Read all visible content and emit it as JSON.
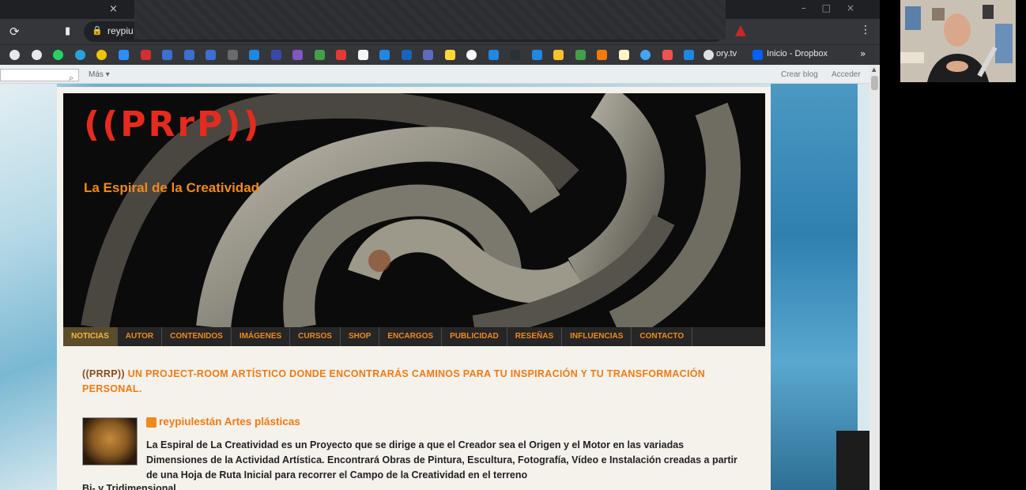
{
  "browser": {
    "tab_close": "×",
    "url": "reypiu",
    "bookmarks": [
      {
        "label": "ory.tv"
      },
      {
        "label": "Inicio - Dropbox"
      }
    ],
    "more_bookmarks": "»"
  },
  "blogger_nav": {
    "more_label": "Más ▾",
    "create_blog": "Crear blog",
    "sign_in": "Acceder"
  },
  "site": {
    "logo": "((PRrP))",
    "tagline": "La Espiral de la Creatividad",
    "menu": [
      {
        "label": "NOTICIAS",
        "active": true
      },
      {
        "label": "AUTOR"
      },
      {
        "label": "CONTENIDOS"
      },
      {
        "label": "IMÁGENES"
      },
      {
        "label": "CURSOS"
      },
      {
        "label": "SHOP"
      },
      {
        "label": "ENCARGOS"
      },
      {
        "label": "PUBLICIDAD"
      },
      {
        "label": "RESEÑAS"
      },
      {
        "label": "INFLUENCIAS"
      },
      {
        "label": "CONTACTO"
      }
    ],
    "intro_prefix": "((PRRP))",
    "intro_text": "UN PROJECT-ROOM ARTÍSTICO DONDE ENCONTRARÁS CAMINOS PARA TU INSPIRACIÓN Y TU TRANSFORMACIÓN PERSONAL.",
    "profile_name": "reypiulestán Artes plásticas",
    "profile_description": "La Espiral de La Creatividad es un Proyecto que se dirige a que el Creador sea el Origen y el Motor en las variadas Dimensiones de la Actividad Artística. Encontrará Obras de Pintura, Escultura, Fotografía, Vídeo e Instalación creadas a partir de una Hoja de Ruta Inicial para recorrer el Campo de la Creatividad en el terreno",
    "profile_description_cont": "Bi- y Tridimensional"
  },
  "colors": {
    "accent_orange": "#f07a14",
    "logo_red": "#e42b1e",
    "menu_bg": "#262626"
  }
}
